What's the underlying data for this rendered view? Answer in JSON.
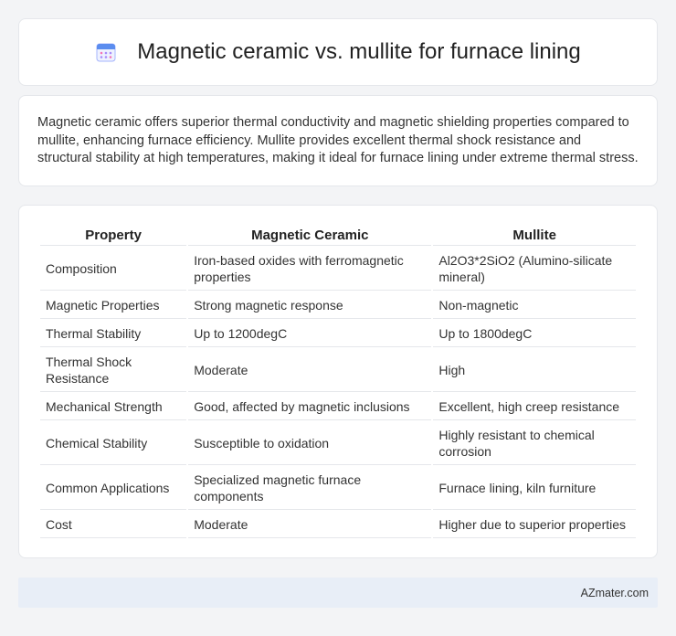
{
  "header": {
    "icon": "calendar-icon",
    "title": "Magnetic ceramic vs. mullite for furnace lining"
  },
  "summary": {
    "text": "Magnetic ceramic offers superior thermal conductivity and magnetic shielding properties compared to mullite, enhancing furnace efficiency. Mullite provides excellent thermal shock resistance and structural stability at high temperatures, making it ideal for furnace lining under extreme thermal stress."
  },
  "table": {
    "headers": [
      "Property",
      "Magnetic Ceramic",
      "Mullite"
    ],
    "rows": [
      [
        "Composition",
        "Iron-based oxides with ferromagnetic properties",
        "Al2O3*2SiO2 (Alumino-silicate mineral)"
      ],
      [
        "Magnetic Properties",
        "Strong magnetic response",
        "Non-magnetic"
      ],
      [
        "Thermal Stability",
        "Up to 1200degC",
        "Up to 1800degC"
      ],
      [
        "Thermal Shock Resistance",
        "Moderate",
        "High"
      ],
      [
        "Mechanical Strength",
        "Good, affected by magnetic inclusions",
        "Excellent, high creep resistance"
      ],
      [
        "Chemical Stability",
        "Susceptible to oxidation",
        "Highly resistant to chemical corrosion"
      ],
      [
        "Common Applications",
        "Specialized magnetic furnace components",
        "Furnace lining, kiln furniture"
      ],
      [
        "Cost",
        "Moderate",
        "Higher due to superior properties"
      ]
    ]
  },
  "footer": {
    "brand": "AZmater.com"
  },
  "colors": {
    "background": "#f3f4f6",
    "card": "#ffffff",
    "footer": "#e8eef7",
    "icon_accent": "#5b8def"
  }
}
